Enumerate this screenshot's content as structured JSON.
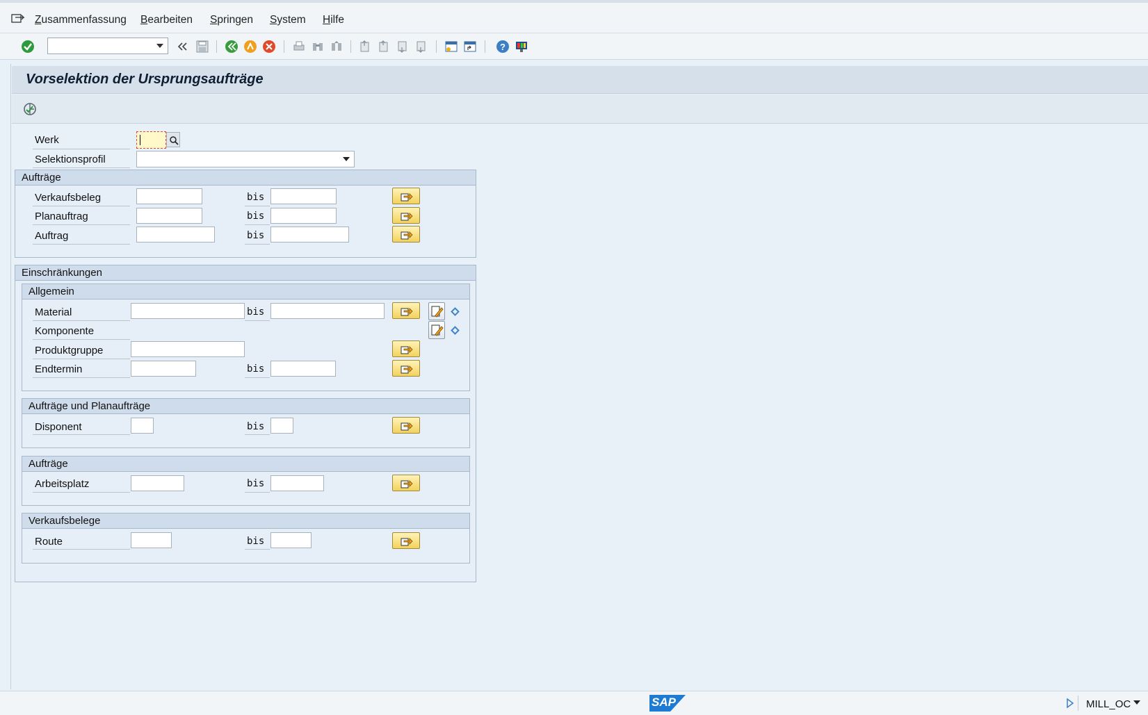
{
  "menu": {
    "summary": {
      "first": "Z",
      "rest": "usammenfassung"
    },
    "edit": {
      "first": "B",
      "rest": "earbeiten"
    },
    "goto": {
      "first": "S",
      "rest": "pringen"
    },
    "system": {
      "first": "S",
      "rest": "ystem"
    },
    "help": {
      "first": "H",
      "rest": "ilfe"
    }
  },
  "toolbar": {
    "command_field_value": "",
    "icons": [
      "enter-icon",
      "back-double-arrow-icon",
      "save-icon",
      "back-icon",
      "exit-icon",
      "cancel-icon",
      "print-icon",
      "find-icon",
      "find-next-icon",
      "first-page-icon",
      "previous-page-icon",
      "next-page-icon",
      "last-page-icon",
      "create-session-icon",
      "shortcut-icon",
      "help-icon",
      "customize-layout-icon"
    ]
  },
  "title": "Vorselektion der Ursprungsaufträge",
  "fields": {
    "werk": {
      "label": "Werk",
      "value": ""
    },
    "selektionsprofil": {
      "label": "Selektionsprofil",
      "value": ""
    }
  },
  "auftraege_group": {
    "title": "Aufträge",
    "rows": [
      {
        "label": "Verkaufsbeleg",
        "bis": "bis"
      },
      {
        "label": "Planauftrag",
        "bis": "bis"
      },
      {
        "label": "Auftrag",
        "bis": "bis"
      }
    ]
  },
  "einschraenkungen": {
    "title": "Einschränkungen",
    "allgemein": {
      "title": "Allgemein",
      "material": {
        "label": "Material",
        "bis": "bis"
      },
      "komponente": {
        "label": "Komponente"
      },
      "produktgruppe": {
        "label": "Produktgruppe"
      },
      "endtermin": {
        "label": "Endtermin",
        "bis": "bis"
      }
    },
    "auftraege_planauftraege": {
      "title": "Aufträge und Planaufträge",
      "disponent": {
        "label": "Disponent",
        "bis": "bis"
      }
    },
    "auftraege": {
      "title": "Aufträge",
      "arbeitsplatz": {
        "label": "Arbeitsplatz",
        "bis": "bis"
      }
    },
    "verkaufsbelege": {
      "title": "Verkaufsbelege",
      "route": {
        "label": "Route",
        "bis": "bis"
      }
    }
  },
  "status": {
    "logo": "SAP",
    "system": "MILL_OC"
  }
}
